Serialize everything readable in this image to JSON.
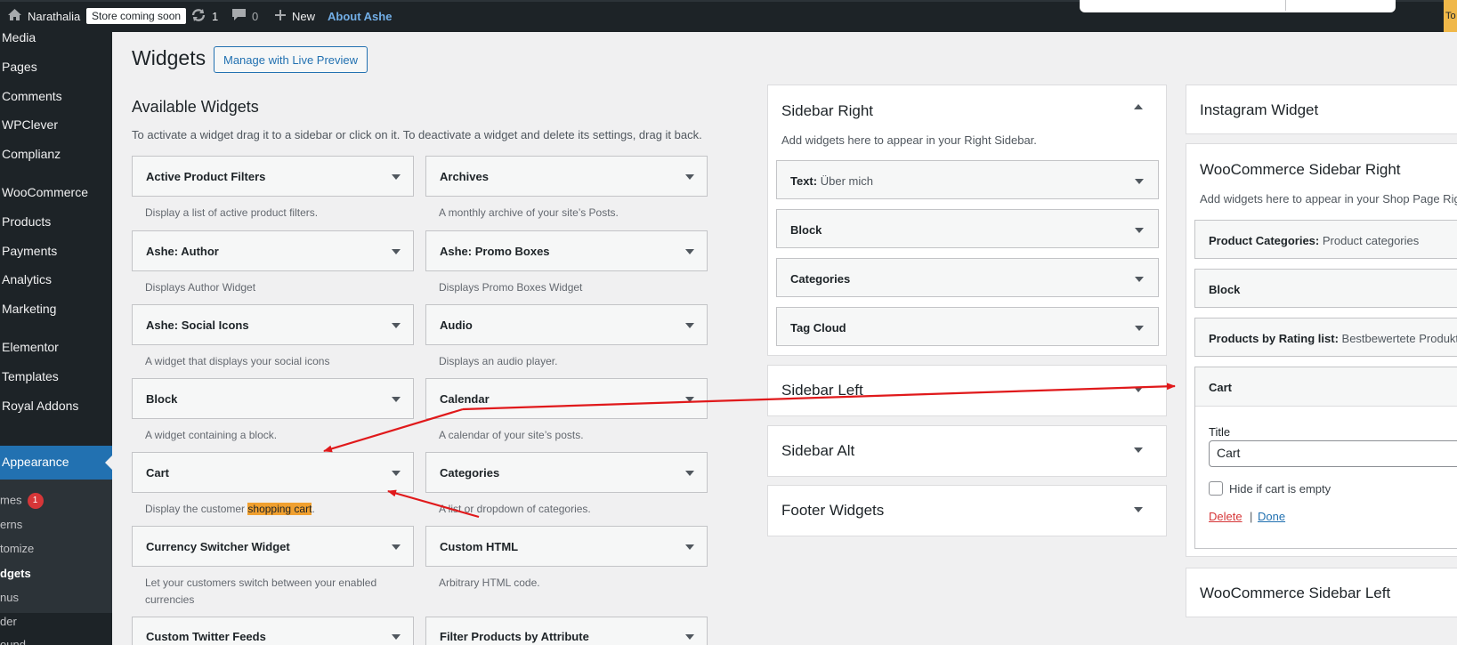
{
  "adminbar": {
    "site_name": "Narathalia",
    "store_badge": "Store coming soon",
    "updates_count": "1",
    "comments_count": "0",
    "new_label": "New",
    "about_label": "About Ashe",
    "corner_text": "To"
  },
  "sidebar": {
    "items": [
      "Media",
      "Pages",
      "Comments",
      "WPClever",
      "Complianz",
      "WooCommerce",
      "Products",
      "Payments",
      "Analytics",
      "Marketing",
      "Elementor",
      "Templates",
      "Royal Addons"
    ],
    "active": "Appearance",
    "submenu": [
      "mes",
      "erns",
      "tomize",
      "dgets",
      "nus",
      "der",
      "ound"
    ],
    "themes_badge": "1"
  },
  "header": {
    "title": "Widgets",
    "live_preview": "Manage with Live Preview"
  },
  "available": {
    "title": "Available Widgets",
    "description": "To activate a widget drag it to a sidebar or click on it. To deactivate a widget and delete its settings, drag it back.",
    "widgets": [
      {
        "title": "Active Product Filters",
        "desc": "Display a list of active product filters."
      },
      {
        "title": "Archives",
        "desc": "A monthly archive of your site’s Posts."
      },
      {
        "title": "Ashe: Author",
        "desc": "Displays Author Widget"
      },
      {
        "title": "Ashe: Promo Boxes",
        "desc": "Displays Promo Boxes Widget"
      },
      {
        "title": "Ashe: Social Icons",
        "desc": "A widget that displays your social icons"
      },
      {
        "title": "Audio",
        "desc": "Displays an audio player."
      },
      {
        "title": "Block",
        "desc": "A widget containing a block."
      },
      {
        "title": "Calendar",
        "desc": "A calendar of your site’s posts."
      },
      {
        "title": "Cart",
        "desc_pre": "Display the customer ",
        "desc_hl": "shopping cart",
        "desc_post": "."
      },
      {
        "title": "Categories",
        "desc": "A list or dropdown of categories."
      },
      {
        "title": "Currency Switcher Widget",
        "desc": "Let your customers switch between your enabled currencies"
      },
      {
        "title": "Custom HTML",
        "desc": "Arbitrary HTML code."
      },
      {
        "title": "Custom Twitter Feeds",
        "desc": ""
      },
      {
        "title": "Filter Products by Attribute",
        "desc": ""
      }
    ]
  },
  "sidebar_right": {
    "title": "Sidebar Right",
    "desc": "Add widgets here to appear in your Right Sidebar.",
    "widgets": [
      {
        "title": "Text:",
        "sub": " Über mich"
      },
      {
        "title": "Block",
        "sub": ""
      },
      {
        "title": "Categories",
        "sub": ""
      },
      {
        "title": "Tag Cloud",
        "sub": ""
      }
    ]
  },
  "areas": {
    "sidebar_left": "Sidebar Left",
    "sidebar_alt": "Sidebar Alt",
    "footer": "Footer Widgets"
  },
  "right_col": {
    "instagram": "Instagram Widget",
    "woo_right_title": "WooCommerce Sidebar Right",
    "woo_right_desc": "Add widgets here to appear in your Shop Page Rig",
    "widgets": [
      {
        "title": "Product Categories:",
        "sub": " Product categories"
      },
      {
        "title": "Block",
        "sub": ""
      },
      {
        "title": "Products by Rating list:",
        "sub": " Bestbewertete Produkte"
      }
    ],
    "cart": {
      "title": "Cart",
      "field_label": "Title",
      "field_value": "Cart",
      "checkbox_label": "Hide if cart is empty",
      "delete": "Delete",
      "sep": "|",
      "done": "Done"
    },
    "woo_left_title": "WooCommerce Sidebar Left"
  },
  "colors": {
    "accent": "#2271b1",
    "annotation": "#e0191b",
    "highlight": "#f0a030"
  }
}
